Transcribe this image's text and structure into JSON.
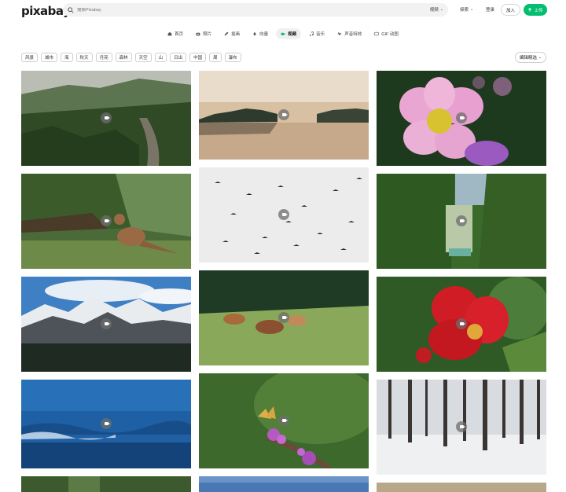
{
  "header": {
    "logo": "pixabay",
    "search_placeholder": "搜索Pixabay",
    "search_scope": "视频",
    "explore": "探索",
    "login": "登录",
    "join": "加入",
    "upload": "上传"
  },
  "media_tabs": [
    {
      "label": "首页",
      "icon": "home-icon"
    },
    {
      "label": "照片",
      "icon": "camera-icon"
    },
    {
      "label": "插画",
      "icon": "pencil-icon"
    },
    {
      "label": "向量",
      "icon": "pen-nib-icon"
    },
    {
      "label": "视频",
      "icon": "video-icon",
      "active": true
    },
    {
      "label": "音乐",
      "icon": "music-icon"
    },
    {
      "label": "声音特效",
      "icon": "waveform-icon"
    },
    {
      "label": "GIF 动图",
      "icon": "gif-icon"
    }
  ],
  "tags": [
    "风景",
    "城市",
    "海",
    "秋天",
    "月亮",
    "森林",
    "天空",
    "山",
    "日出",
    "中国",
    "周",
    "瀑布"
  ],
  "sort_label": "编辑精选",
  "colors": {
    "accent": "#02be6e"
  }
}
